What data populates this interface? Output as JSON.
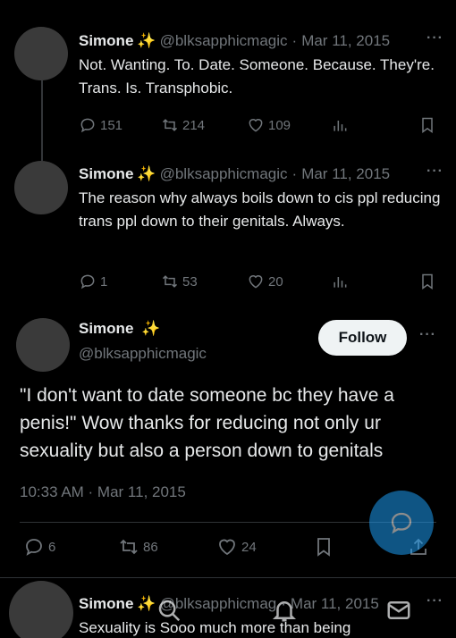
{
  "tweets": [
    {
      "name": "Simone",
      "handle": "@blksapphicmagic",
      "date": "Mar 11, 2015",
      "text": "Not. Wanting. To. Date. Someone. Because. They're. Trans. Is. Transphobic.",
      "replies": "151",
      "retweets": "214",
      "likes": "109"
    },
    {
      "name": "Simone",
      "handle": "@blksapphicmagic",
      "date": "Mar 11, 2015",
      "text": "The reason why always boils down to cis ppl reducing trans ppl down to their genitals. Always.",
      "replies": "1",
      "retweets": "53",
      "likes": "20"
    }
  ],
  "main": {
    "name": "Simone",
    "handle": "@blksapphicmagic",
    "follow_label": "Follow",
    "text": "\"I don't want to date someone bc they have a penis!\" Wow thanks for reducing not only ur sexuality but also a person down to genitals",
    "timestamp": "10:33 AM · Mar 11, 2015",
    "replies": "6",
    "retweets": "86",
    "likes": "24"
  },
  "next_tweet": {
    "name": "Simone",
    "handle": "@blksapphicmag",
    "date": "Mar 11, 2015",
    "text": "Sexuality is Sooo much more than being"
  },
  "icons": {
    "sparkle": "✨",
    "more": "···",
    "dot": "·"
  },
  "colors": {
    "background": "#000000",
    "text": "#e7e9ea",
    "muted": "#71767b",
    "accent": "#1d9bf0",
    "follow_bg": "#eff3f4"
  }
}
